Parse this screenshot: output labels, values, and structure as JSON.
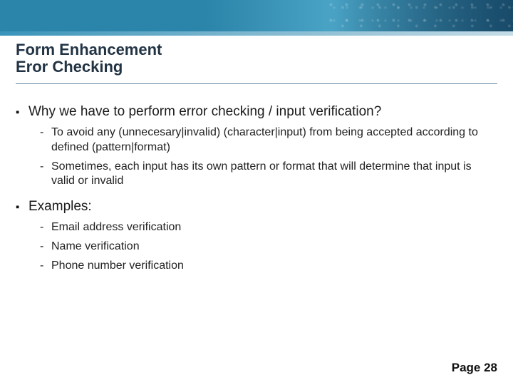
{
  "title": {
    "line1": "Form Enhancement",
    "line2": "Eror Checking"
  },
  "body": {
    "sections": [
      {
        "heading": "Why we have to perform error checking / input verification?",
        "items": [
          "To avoid any (unnecesary|invalid) (character|input) from being accepted according to defined (pattern|format)",
          "Sometimes, each input has its own pattern or format that will determine that input is valid or invalid"
        ]
      },
      {
        "heading": "Examples:",
        "items": [
          "Email address verification",
          "Name verification",
          "Phone number verification"
        ]
      }
    ]
  },
  "footer": {
    "page_label": "Page 28"
  }
}
